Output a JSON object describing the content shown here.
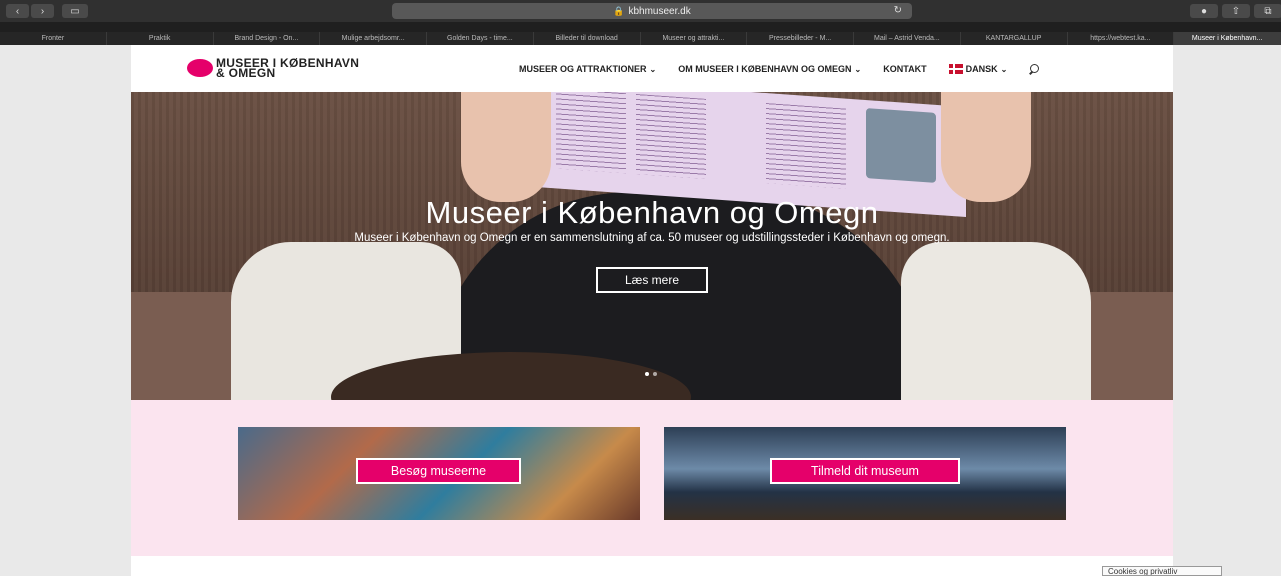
{
  "browser": {
    "url": "kbhmuseer.dk",
    "bookmarks": [
      {
        "label": "Fronter",
        "active": false
      },
      {
        "label": "Praktik",
        "active": false
      },
      {
        "label": "Brand Design - On...",
        "active": false
      },
      {
        "label": "Mulige arbejdsomr...",
        "active": false
      },
      {
        "label": "Golden Days - time...",
        "active": false
      },
      {
        "label": "Billeder til download",
        "active": false
      },
      {
        "label": "Museer og attrakti...",
        "active": false
      },
      {
        "label": "Pressebilleder - M...",
        "active": false
      },
      {
        "label": "Mail – Astrid Venda...",
        "active": false
      },
      {
        "label": "KANTARGALLUP",
        "active": false
      },
      {
        "label": "https://webtest.ka...",
        "active": false
      },
      {
        "label": "Museer i København...",
        "active": true
      }
    ]
  },
  "header": {
    "logo_line1": "MUSEER I KØBENHAVN",
    "logo_line2": "& OMEGN",
    "menu": {
      "museums": "MUSEER OG ATTRAKTIONER",
      "about": "OM MUSEER I KØBENHAVN OG OMEGN",
      "contact": "KONTAKT",
      "language": "DANSK"
    },
    "chevron": "⌄"
  },
  "hero": {
    "title": "Museer i København og Omegn",
    "subtitle": "Museer i København og Omegn er en sammenslutning af ca. 50 museer og udstillingssteder i København og omegn.",
    "button": "Læs mere"
  },
  "cards": {
    "left_button": "Besøg museerne",
    "right_button": "Tilmeld dit museum"
  },
  "cookie_tooltip": "Cookies og privatliv",
  "colors": {
    "brand_pink": "#e5006a",
    "band_pink": "#fbe4ef"
  }
}
